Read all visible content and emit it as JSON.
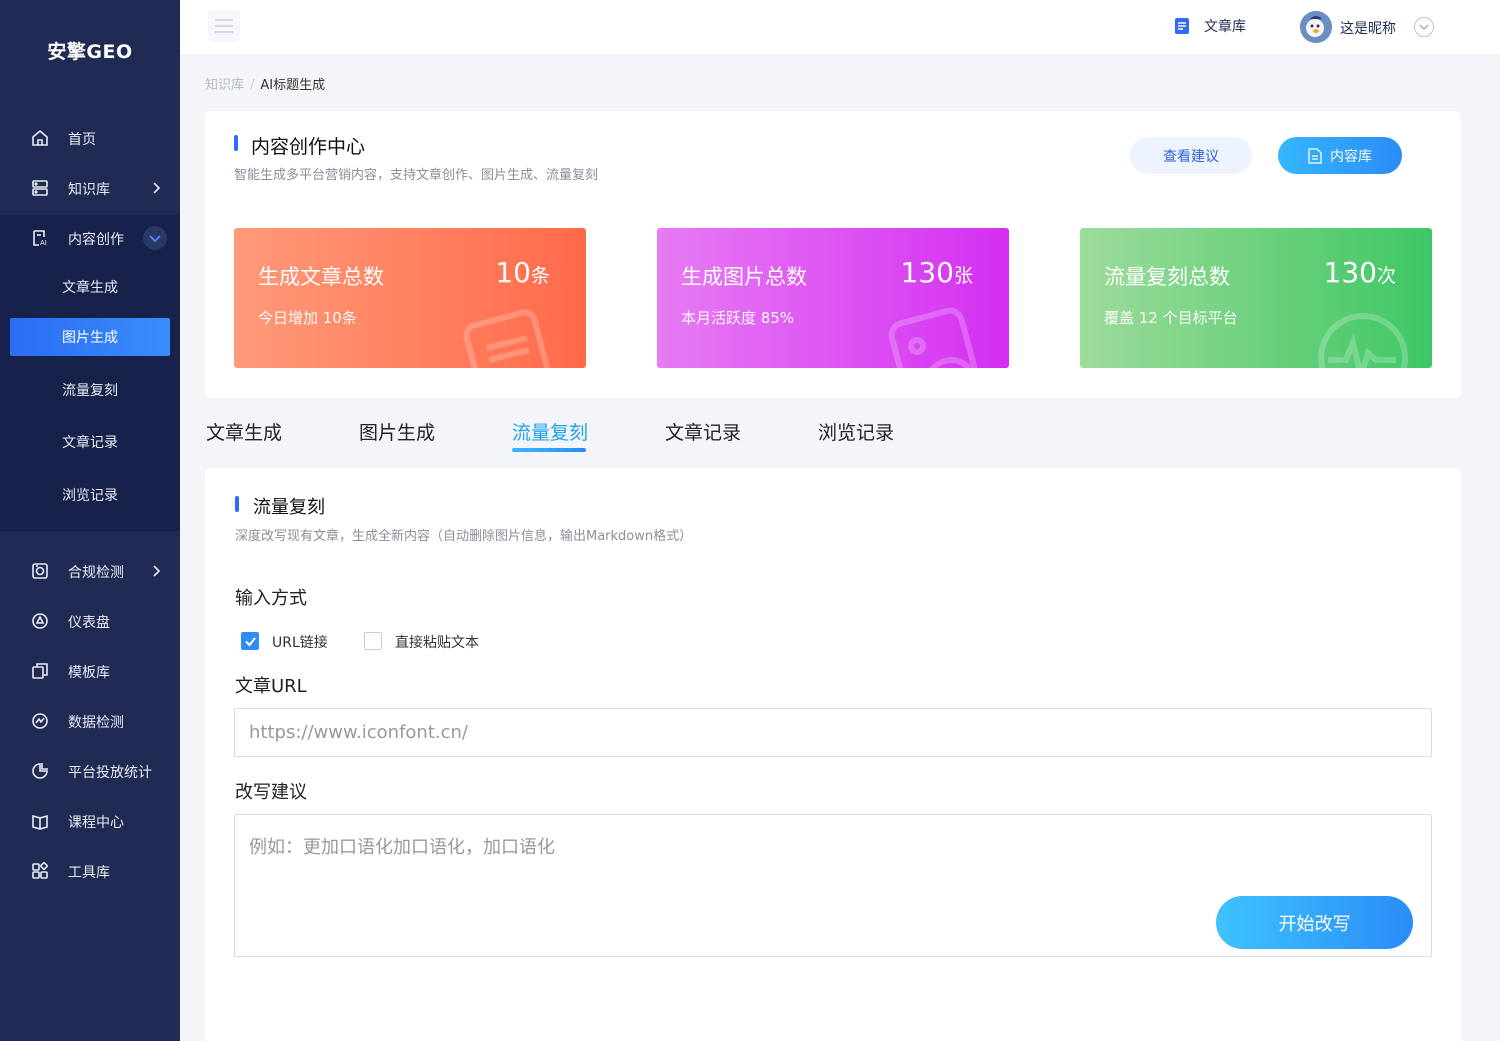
{
  "app": {
    "title": "安擎GEO"
  },
  "sidebar": {
    "items": [
      {
        "label": "首页",
        "icon": "home-icon"
      },
      {
        "label": "知识库",
        "icon": "database-icon"
      },
      {
        "label": "内容创作",
        "icon": "ai-doc-icon"
      },
      {
        "label": "合规检测",
        "icon": "compliance-icon"
      },
      {
        "label": "仪表盘",
        "icon": "dashboard-icon"
      },
      {
        "label": "模板库",
        "icon": "template-icon"
      },
      {
        "label": "数据检测",
        "icon": "chart-icon"
      },
      {
        "label": "平台投放统计",
        "icon": "pie-icon"
      },
      {
        "label": "课程中心",
        "icon": "book-icon"
      },
      {
        "label": "工具库",
        "icon": "grid-icon"
      }
    ],
    "sub_items": [
      "文章生成",
      "图片生成",
      "流量复刻",
      "文章记录",
      "浏览记录"
    ],
    "active_sub": "图片生成"
  },
  "header": {
    "article_lib": "文章库",
    "nickname": "这是昵称"
  },
  "breadcrumb": {
    "parent": "知识库",
    "separator": "/",
    "current": "AI标题生成"
  },
  "creation_center": {
    "title": "内容创作中心",
    "subtitle": "智能生成多平台营销内容，支持文章创作、图片生成、流量复刻",
    "advice_button": "查看建议",
    "library_button": "内容库"
  },
  "stats": [
    {
      "title": "生成文章总数",
      "value": "10",
      "unit": "条",
      "sub": "今日增加  10条",
      "color_from": "#ff9a7a",
      "color_to": "#ff6a4a"
    },
    {
      "title": "生成图片总数",
      "value": "130",
      "unit": "张",
      "sub": "本月活跃度  85%",
      "color_from": "#e77cf3",
      "color_to": "#d42ff2"
    },
    {
      "title": "流量复刻总数",
      "value": "130",
      "unit": "次",
      "sub": "覆盖  12  个目标平台",
      "color_from": "#9edc9a",
      "color_to": "#3ec765"
    }
  ],
  "tabs": [
    "文章生成",
    "图片生成",
    "流量复刻",
    "文章记录",
    "浏览记录"
  ],
  "active_tab": "流量复刻",
  "traffic_copy": {
    "title": "流量复刻",
    "subtitle": "深度改写现有文章，生成全新内容（自动删除图片信息，输出Markdown格式）",
    "input_method_label": "输入方式",
    "option_url": "URL链接",
    "option_paste": "直接粘贴文本",
    "url_label": "文章URL",
    "url_placeholder": "https://www.iconfont.cn/",
    "advice_label": "改写建议",
    "advice_placeholder": "例如：更加口语化加口语化，加口语化",
    "start_button": "开始改写"
  }
}
